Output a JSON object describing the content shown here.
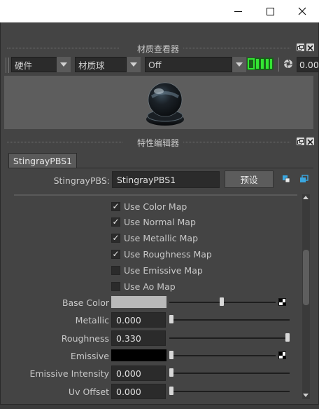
{
  "window": {
    "minimize_icon": "minimize-icon",
    "maximize_icon": "maximize-icon",
    "close_icon": "close-icon"
  },
  "material_viewer": {
    "title": "材质查看器",
    "renderer": "硬件",
    "shape": "材质球",
    "env": "Off",
    "exposure": "0.00"
  },
  "attribute_editor": {
    "title": "特性编辑器",
    "tab_label": "StingrayPBS1",
    "node_type_label": "StingrayPBS:",
    "node_name": "StingrayPBS1",
    "presets_label": "预设",
    "checkboxes": [
      {
        "label": "Use Color Map",
        "checked": true
      },
      {
        "label": "Use Normal Map",
        "checked": true
      },
      {
        "label": "Use Metallic Map",
        "checked": true
      },
      {
        "label": "Use Roughness Map",
        "checked": true
      },
      {
        "label": "Use Emissive Map",
        "checked": false
      },
      {
        "label": "Use Ao Map",
        "checked": false
      }
    ],
    "attributes": {
      "base_color": {
        "label": "Base Color",
        "color": "#b9b9b9",
        "slider": 0.45
      },
      "metallic": {
        "label": "Metallic",
        "value": "0.000",
        "slider": 0.0
      },
      "roughness": {
        "label": "Roughness",
        "value": "0.330",
        "slider": 1.0
      },
      "emissive": {
        "label": "Emissive",
        "color": "#000000",
        "slider": 0.0
      },
      "emissive_intensity": {
        "label": "Emissive Intensity",
        "value": "0.000",
        "slider": 0.0
      },
      "uv_offset": {
        "label": "Uv Offset",
        "value": "0.000",
        "slider": 0.0
      }
    }
  },
  "colors": {
    "panel_bg": "#444444",
    "field_bg": "#2b2b2b",
    "status_green": "#22cc22"
  }
}
